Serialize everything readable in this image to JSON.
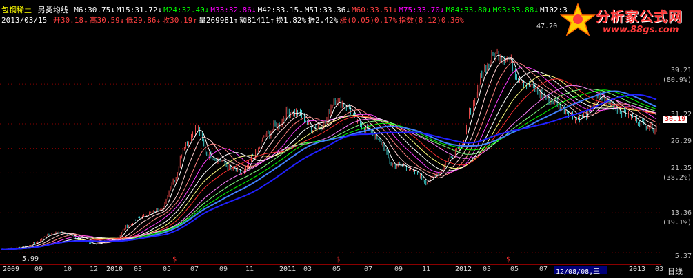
{
  "stock": {
    "name": "包钢稀土",
    "indicator": "另类均线",
    "date": "2013/03/15"
  },
  "ma_values": [
    {
      "label": "M6:30.75",
      "arrow": "↓",
      "color": "#ffffff"
    },
    {
      "label": "M15:31.72",
      "arrow": "↓",
      "color": "#ffffff"
    },
    {
      "label": "M24:32.40",
      "arrow": "↓",
      "color": "#00ff00"
    },
    {
      "label": "M33:32.86",
      "arrow": "↓",
      "color": "#ff00ff"
    },
    {
      "label": "M42:33.15",
      "arrow": "↓",
      "color": "#ffffff"
    },
    {
      "label": "M51:33.36",
      "arrow": "↓",
      "color": "#ffffff"
    },
    {
      "label": "M60:33.51",
      "arrow": "↓",
      "color": "#ff4040"
    },
    {
      "label": "M75:33.70",
      "arrow": "↓",
      "color": "#ff00ff"
    },
    {
      "label": "M84:33.80",
      "arrow": "↓",
      "color": "#00ff00"
    },
    {
      "label": "M93:33.88",
      "arrow": "↓",
      "color": "#00ff00"
    },
    {
      "label": "M102:3",
      "arrow": "",
      "color": "#ffffff"
    }
  ],
  "quote": [
    {
      "label": "开",
      "value": "30.18",
      "arrow": "↓",
      "color": "#ff4040"
    },
    {
      "label": "高",
      "value": "30.59",
      "arrow": "↓",
      "color": "#ff4040"
    },
    {
      "label": "低",
      "value": "29.86",
      "arrow": "↓",
      "color": "#ff4040"
    },
    {
      "label": "收",
      "value": "30.19",
      "arrow": "↑",
      "color": "#ff4040"
    },
    {
      "label": "量",
      "value": "269981",
      "arrow": "↑",
      "color": "#ffffff"
    },
    {
      "label": "额",
      "value": "81411",
      "arrow": "↑",
      "color": "#ffffff"
    },
    {
      "label": "换",
      "value": "1.82%",
      "arrow": "",
      "color": "#ffffff"
    },
    {
      "label": "振",
      "value": "2.42%",
      "arrow": "",
      "color": "#ffffff"
    },
    {
      "label": "涨",
      "value": "(0.05)0.17%",
      "arrow": "",
      "color": "#ff4040"
    },
    {
      "label": "指数",
      "value": "(8.12)0.36%",
      "arrow": "",
      "color": "#ff4040"
    }
  ],
  "y_axis": {
    "labels": [
      "39.21",
      "31.22",
      "26.29",
      "21.35",
      "13.36",
      "5.37"
    ],
    "pct": [
      "(80.9%)",
      "(38.2%)",
      "(19.1%)"
    ],
    "current_price": "30.19"
  },
  "peaks": {
    "high": "47.20",
    "low": "5.99"
  },
  "x_axis": {
    "labels": [
      "2009",
      "09",
      "10",
      "12",
      "2010",
      "03",
      "05",
      "07",
      "09",
      "11",
      "2011",
      "03",
      "05",
      "07",
      "09",
      "11",
      "2012",
      "03",
      "05",
      "07",
      "2013",
      "03"
    ],
    "current_date": "12/08/08,三",
    "period": "日线"
  },
  "logo": {
    "title": "分析家公式网",
    "url": "www.88gs.com"
  },
  "colors": {
    "background": "#000000",
    "up": "#ff4040",
    "down": "#00ffff",
    "axis": "#8b0000"
  },
  "chart_data": {
    "type": "line",
    "title": "",
    "series": [
      {
        "values": [
          6.0,
          6.2,
          6.6,
          7.3,
          8.9,
          9.5,
          8.9,
          7.8,
          7.1,
          7.6,
          8.2,
          10.8,
          12.4,
          13.3,
          14.4,
          19.9,
          27.2,
          30.4,
          24.9,
          24.0,
          22.2,
          21.3,
          25.0,
          28.8,
          31.0,
          33.7,
          33.2,
          30.3,
          30.9,
          36.0,
          34.8,
          31.4,
          30.0,
          27.4,
          23.0,
          22.8,
          21.4,
          19.7,
          21.3,
          24.4,
          27.3,
          34.6,
          42.2,
          45.2,
          44.6,
          40.5,
          38.8,
          37.0,
          35.8,
          34.0,
          32.2,
          33.1,
          36.7,
          35.5,
          33.5,
          32.4,
          31.0,
          30.2
        ]
      }
    ]
  }
}
